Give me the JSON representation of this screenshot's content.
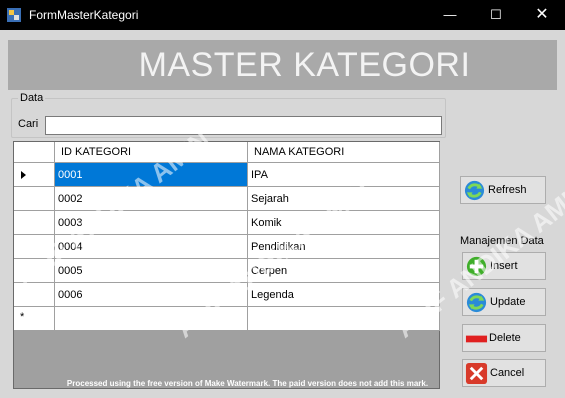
{
  "window": {
    "title": "FormMasterKategori",
    "minimize_symbol": "—",
    "maximize_symbol": "☐",
    "close_symbol": "✕"
  },
  "header": {
    "title": "MASTER KATEGORI"
  },
  "data_group": {
    "legend": "Data",
    "search_label": "Cari",
    "search_value": ""
  },
  "table": {
    "columns": [
      "ID KATEGORI",
      "NAMA KATEGORI"
    ],
    "rows": [
      {
        "id": "0001",
        "nama": "IPA"
      },
      {
        "id": "0002",
        "nama": "Sejarah"
      },
      {
        "id": "0003",
        "nama": "Komik"
      },
      {
        "id": "0004",
        "nama": "Pendidikan"
      },
      {
        "id": "0005",
        "nama": "Cerpen"
      },
      {
        "id": "0006",
        "nama": "Legenda"
      }
    ],
    "new_row_marker": "*",
    "selected_row": 0
  },
  "buttons": {
    "refresh": "Refresh",
    "manage_group_label": "Manajemen Data",
    "insert": "Insert",
    "update": "Update",
    "delete": "Delete",
    "cancel": "Cancel"
  },
  "watermark": {
    "text": "ALIF ANDIKA AMIN",
    "footer": "Processed using the free version of Make Watermark. The paid version does not add this mark."
  },
  "colors": {
    "titlebar": "#000000",
    "selection": "#0078d7",
    "banner": "#a9a9a9"
  }
}
